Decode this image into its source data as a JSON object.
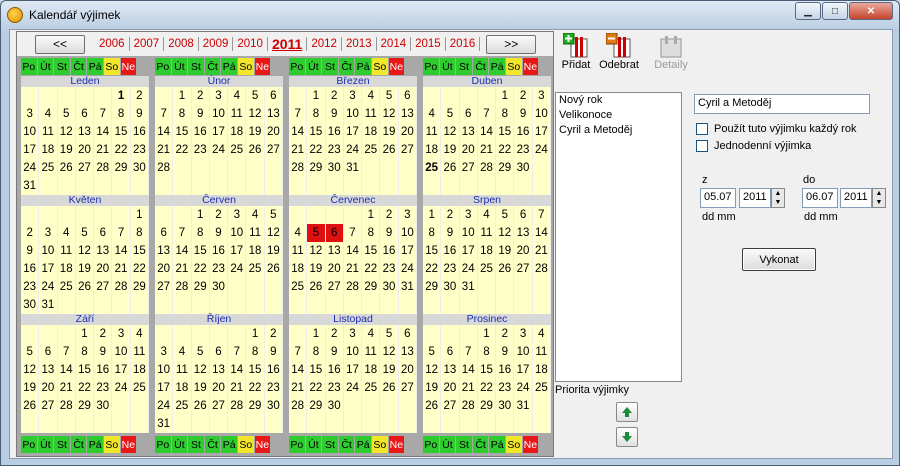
{
  "window": {
    "title": "Kalendář výjimek",
    "minimize_icon": "minimize-icon",
    "maximize_icon": "maximize-icon",
    "close_icon": "close-icon"
  },
  "year_nav": {
    "prev": "<<",
    "next": ">>",
    "years": [
      "2006",
      "2007",
      "2008",
      "2009",
      "2010",
      "2011",
      "2012",
      "2013",
      "2014",
      "2015",
      "2016"
    ],
    "current": "2011"
  },
  "day_headers": [
    "Po",
    "Út",
    "St",
    "Čt",
    "Pá",
    "So",
    "Ne"
  ],
  "months": [
    {
      "name": "Leden",
      "offset": 5,
      "days": 31,
      "bold": [
        1
      ],
      "red": []
    },
    {
      "name": "Únor",
      "offset": 1,
      "days": 28,
      "bold": [],
      "red": []
    },
    {
      "name": "Březen",
      "offset": 1,
      "days": 31,
      "bold": [],
      "red": []
    },
    {
      "name": "Duben",
      "offset": 4,
      "days": 30,
      "bold": [
        25
      ],
      "red": []
    },
    {
      "name": "Květen",
      "offset": 6,
      "days": 31,
      "bold": [],
      "red": []
    },
    {
      "name": "Červen",
      "offset": 2,
      "days": 30,
      "bold": [],
      "red": []
    },
    {
      "name": "Červenec",
      "offset": 4,
      "days": 31,
      "bold": [],
      "red": [
        5,
        6
      ]
    },
    {
      "name": "Srpen",
      "offset": 0,
      "days": 31,
      "bold": [],
      "red": []
    },
    {
      "name": "Září",
      "offset": 3,
      "days": 30,
      "bold": [],
      "red": []
    },
    {
      "name": "Říjen",
      "offset": 5,
      "days": 31,
      "bold": [],
      "red": []
    },
    {
      "name": "Listopad",
      "offset": 1,
      "days": 30,
      "bold": [],
      "red": []
    },
    {
      "name": "Prosinec",
      "offset": 3,
      "days": 31,
      "bold": [],
      "red": []
    }
  ],
  "toolbar": {
    "add": "Přidat",
    "remove": "Odebrat",
    "details": "Detaily"
  },
  "exceptions": [
    "Nový rok",
    "Velikonoce",
    "Cyril a Metoděj"
  ],
  "selected_name": "Cyril a Metoděj",
  "options": {
    "every_year": "Použít tuto výjimku každý rok",
    "one_day": "Jednodenní výjimka"
  },
  "range": {
    "from_label": "z",
    "to_label": "do",
    "from_date": "05.07",
    "from_year": "2011",
    "to_date": "06.07",
    "to_year": "2011",
    "format": "dd mm"
  },
  "execute": "Vykonat",
  "priority_label": "Priorita výjimky",
  "colors": {
    "weekday": "#2ecc2e",
    "saturday": "#f2e62a",
    "sunday": "#e81818",
    "day_bg": "#ffffc8",
    "highlight": "#e01010"
  }
}
